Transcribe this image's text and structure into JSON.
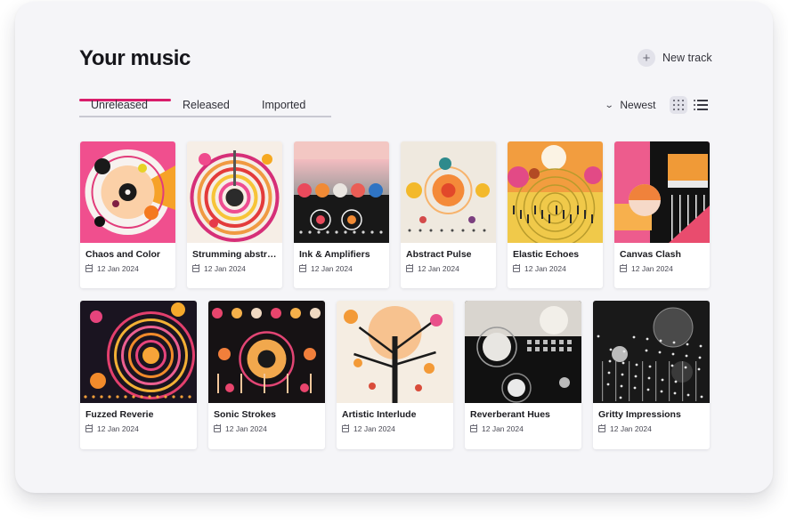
{
  "header": {
    "title": "Your music",
    "new_track_label": "New track"
  },
  "tabs": [
    {
      "label": "Unreleased",
      "active": true
    },
    {
      "label": "Released",
      "active": false
    },
    {
      "label": "Imported",
      "active": false
    }
  ],
  "sort": {
    "label": "Newest"
  },
  "view": {
    "mode": "grid"
  },
  "icons": {
    "add": "plus-icon",
    "sort": "chevron-down-icon",
    "grid_view": "grid-view-icon",
    "list_view": "list-view-icon",
    "date": "calendar-icon"
  },
  "colors": {
    "accent": "#d91d6b",
    "panel": "#f5f5f8"
  },
  "tracks": [
    {
      "title": "Chaos and Color",
      "date": "12 Jan 2024"
    },
    {
      "title": "Strumming abstr…",
      "date": "12 Jan 2024"
    },
    {
      "title": "Ink & Amplifiers",
      "date": "12 Jan 2024"
    },
    {
      "title": "Abstract Pulse",
      "date": "12 Jan 2024"
    },
    {
      "title": "Elastic Echoes",
      "date": "12 Jan 2024"
    },
    {
      "title": "Canvas Clash",
      "date": "12 Jan 2024"
    },
    {
      "title": "Fuzzed Reverie",
      "date": "12 Jan 2024"
    },
    {
      "title": "Sonic Strokes",
      "date": "12 Jan 2024"
    },
    {
      "title": "Artistic Interlude",
      "date": "12 Jan 2024"
    },
    {
      "title": "Reverberant Hues",
      "date": "12 Jan 2024"
    },
    {
      "title": "Gritty Impressions",
      "date": "12 Jan 2024"
    }
  ]
}
